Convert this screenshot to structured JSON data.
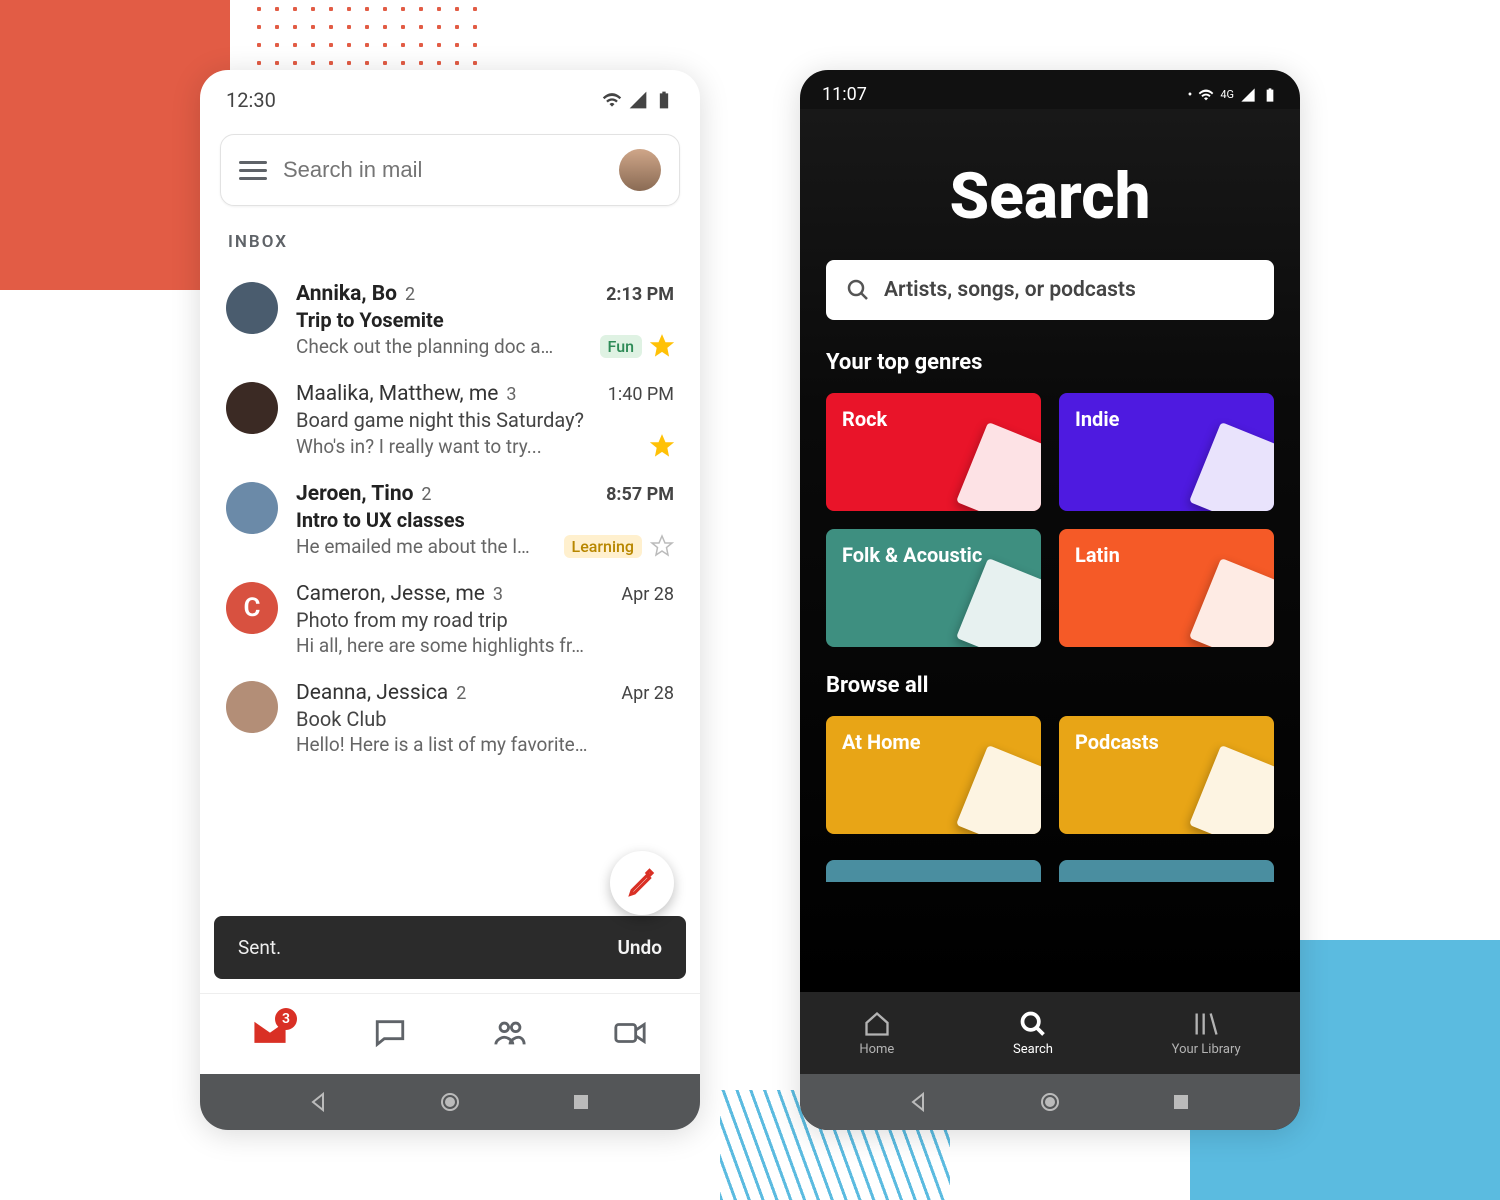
{
  "gmail": {
    "status": {
      "time": "12:30"
    },
    "search": {
      "placeholder": "Search in mail"
    },
    "section_label": "INBOX",
    "emails": [
      {
        "sender": "Annika, Bo",
        "count": "2",
        "time": "2:13 PM",
        "subject": "Trip to Yosemite",
        "snippet": "Check out the planning doc a…",
        "tag": "Fun",
        "tag_class": "fun",
        "bold": true,
        "starred": true,
        "avatar_bg": "#4a5c6e"
      },
      {
        "sender": "Maalika, Matthew, me",
        "count": "3",
        "time": "1:40 PM",
        "subject": "Board game night this Saturday?",
        "snippet": "Who's in? I really want to try...",
        "tag": "",
        "bold": false,
        "starred": true,
        "avatar_bg": "#3b2a24"
      },
      {
        "sender": "Jeroen, Tino",
        "count": "2",
        "time": "8:57 PM",
        "subject": "Intro to UX classes",
        "snippet": "He emailed me about the l…",
        "tag": "Learning",
        "tag_class": "learning",
        "bold": true,
        "starred": false,
        "avatar_bg": "#6b8aa8"
      },
      {
        "sender": "Cameron, Jesse, me",
        "count": "3",
        "time": "Apr 28",
        "subject": "Photo from my road trip",
        "snippet": "Hi all, here are some highlights fr…",
        "tag": "",
        "bold": false,
        "starred": null,
        "avatar_bg": "#D85140",
        "avatar_letter": "C"
      },
      {
        "sender": "Deanna, Jessica",
        "count": "2",
        "time": "Apr 28",
        "subject": "Book Club",
        "snippet": "Hello! Here is a list of my favorite…",
        "tag": "",
        "bold": false,
        "starred": null,
        "avatar_bg": "#b38e77"
      }
    ],
    "snackbar": {
      "text": "Sent.",
      "action": "Undo"
    },
    "bottom_nav": {
      "mail_badge": "3",
      "items": [
        "Mail",
        "Chat",
        "Spaces",
        "Meet"
      ]
    }
  },
  "spotify": {
    "status": {
      "time": "11:07",
      "net_label": "4G"
    },
    "title": "Search",
    "search": {
      "placeholder": "Artists, songs, or podcasts"
    },
    "sections": {
      "top_genres": {
        "label": "Your top genres",
        "cards": [
          {
            "label": "Rock",
            "color": "#E91429"
          },
          {
            "label": "Indie",
            "color": "#4E1AE0"
          },
          {
            "label": "Folk & Acoustic",
            "color": "#3E8F80"
          },
          {
            "label": "Latin",
            "color": "#F55A27"
          }
        ]
      },
      "browse_all": {
        "label": "Browse all",
        "cards": [
          {
            "label": "At Home",
            "color": "#E8A516"
          },
          {
            "label": "Podcasts",
            "color": "#E8A516"
          }
        ],
        "tease_colors": [
          "#4A8EA0",
          "#4A8EA0"
        ]
      }
    },
    "bottom_nav": {
      "home": "Home",
      "search": "Search",
      "library": "Your Library"
    }
  }
}
